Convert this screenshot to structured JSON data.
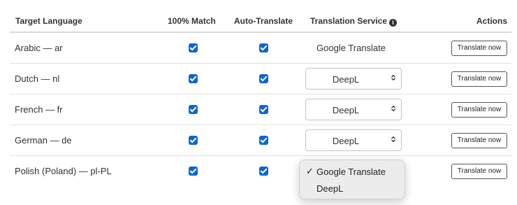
{
  "headers": {
    "target_language": "Target Language",
    "match": "100% Match",
    "auto_translate": "Auto-Translate",
    "service": "Translation Service",
    "actions": "Actions"
  },
  "rows": [
    {
      "language": "Arabic — ar",
      "match_checked": true,
      "auto_checked": true,
      "service": "Google Translate",
      "service_is_select": false,
      "action": "Translate now"
    },
    {
      "language": "Dutch — nl",
      "match_checked": true,
      "auto_checked": true,
      "service": "DeepL",
      "service_is_select": true,
      "action": "Translate now"
    },
    {
      "language": "French — fr",
      "match_checked": true,
      "auto_checked": true,
      "service": "DeepL",
      "service_is_select": true,
      "action": "Translate now"
    },
    {
      "language": "German — de",
      "match_checked": true,
      "auto_checked": true,
      "service": "DeepL",
      "service_is_select": true,
      "action": "Translate now"
    },
    {
      "language": "Polish (Poland) — pl-PL",
      "match_checked": true,
      "auto_checked": true,
      "service": "Google Translate",
      "service_is_select": true,
      "action": "Translate now"
    }
  ],
  "dropdown": {
    "options": [
      {
        "label": "Google Translate",
        "selected": true
      },
      {
        "label": "DeepL",
        "selected": false
      }
    ],
    "check_glyph": "✓"
  },
  "colors": {
    "checkbox": "#0a66d6",
    "header_border": "#d9d9d9",
    "row_border": "#e2e2e2",
    "text": "#333333"
  },
  "icons": {
    "info": "info-icon",
    "select_arrow": "chevron-up-down-icon",
    "checkbox_mark": "checkmark-icon"
  }
}
